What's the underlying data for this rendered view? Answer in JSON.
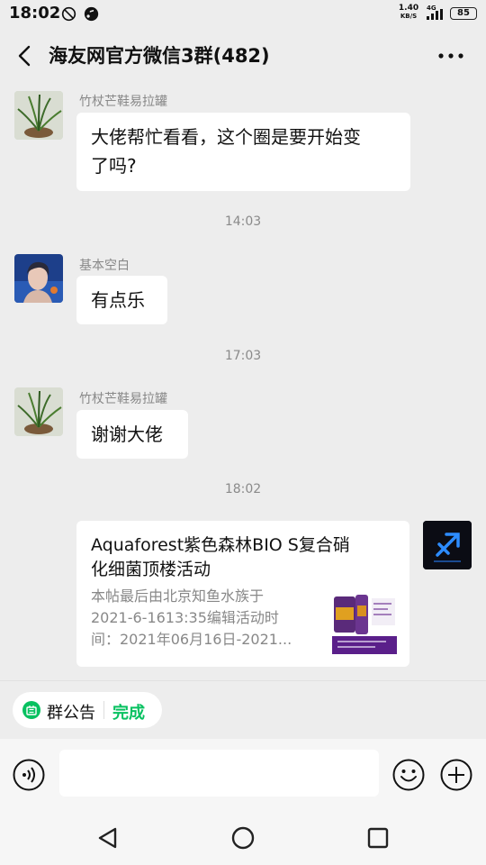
{
  "status_bar": {
    "time": "18:02",
    "net_speed_value": "1.40",
    "net_speed_unit": "KB/S",
    "network": "4G",
    "battery": "85"
  },
  "header": {
    "title": "海友网官方微信3群(482)",
    "back_icon": "chevron-left-icon",
    "more_icon": "more-dots-icon"
  },
  "messages": [
    {
      "sender": "竹杖芒鞋易拉罐",
      "text": "大佬帮忙看看，这个圈是要开始变了吗?"
    },
    {
      "timestamp": "14:03"
    },
    {
      "sender": "基本空白",
      "text": "有点乐"
    },
    {
      "timestamp": "17:03"
    },
    {
      "sender": "竹杖芒鞋易拉罐",
      "text": "谢谢大佬"
    },
    {
      "timestamp": "18:02"
    }
  ],
  "msg1": {
    "sender": "竹杖芒鞋易拉罐",
    "line1": "大佬帮忙看看，这个圈是要开始变",
    "line2": "了吗?"
  },
  "ts1": "14:03",
  "msg2": {
    "sender": "基本空白",
    "text": "有点乐"
  },
  "ts2": "17:03",
  "msg3": {
    "sender": "竹杖芒鞋易拉罐",
    "text": "谢谢大佬"
  },
  "ts3": "18:02",
  "link_card": {
    "title_line1": "Aquaforest紫色森林BIO S复合硝",
    "title_line2": "化细菌顶楼活动",
    "desc_line1": "本帖最后由北京知鱼水族于",
    "desc_line2": "2021-6-1613:35编辑活动时",
    "desc_line3": "间：2021年06月16日-2021..."
  },
  "announcement": {
    "label": "群公告",
    "done": "完成"
  },
  "input": {
    "placeholder": "",
    "value": ""
  },
  "colors": {
    "background": "#ededed",
    "bubble": "#ffffff",
    "accent_green": "#07c160",
    "meta_text": "#888888"
  }
}
